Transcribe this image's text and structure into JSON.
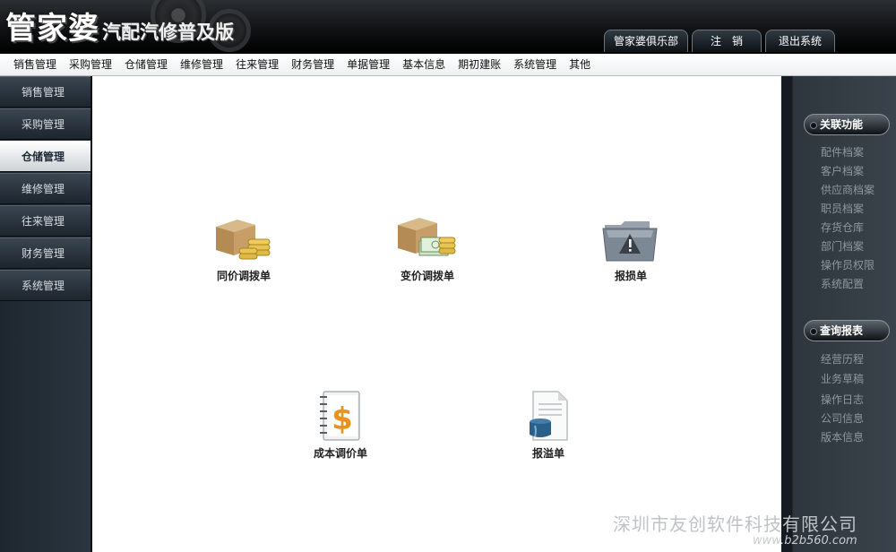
{
  "header": {
    "logo_main": "管家婆",
    "logo_sub": "汽配汽修普及版",
    "buttons": [
      "管家婆俱乐部",
      "注　销",
      "退出系统"
    ]
  },
  "menu": [
    "销售管理",
    "采购管理",
    "仓储管理",
    "维修管理",
    "往来管理",
    "财务管理",
    "单据管理",
    "基本信息",
    "期初建账",
    "系统管理",
    "其他"
  ],
  "sidebar": {
    "items": [
      "销售管理",
      "采购管理",
      "仓储管理",
      "维修管理",
      "往来管理",
      "财务管理",
      "系统管理"
    ],
    "active_index": 2
  },
  "main": {
    "tiles": [
      {
        "label": "同价调拨单",
        "icon": "box-coins-icon"
      },
      {
        "label": "变价调拨单",
        "icon": "box-cash-icon"
      },
      {
        "label": "报损单",
        "icon": "warning-folder-icon"
      },
      {
        "label": "成本调价单",
        "icon": "dollar-notebook-icon"
      },
      {
        "label": "报溢单",
        "icon": "paint-document-icon"
      }
    ]
  },
  "right_panel": {
    "related_title": "关联功能",
    "related_links": [
      "配件档案",
      "客户档案",
      "供应商档案",
      "职员档案",
      "存货仓库",
      "部门档案",
      "操作员权限",
      "系统配置"
    ],
    "report_title": "查询报表",
    "report_links": [
      "经营历程",
      "业务草稿",
      "操作日志",
      "公司信息",
      "版本信息"
    ]
  },
  "watermark": {
    "company": "深圳市友创软件科技有限公司",
    "site": "www.b2b560.com"
  },
  "colors": {
    "accent_dark": "#1e272f",
    "active_item": "#ffffff",
    "link_gray": "#8e979f"
  }
}
